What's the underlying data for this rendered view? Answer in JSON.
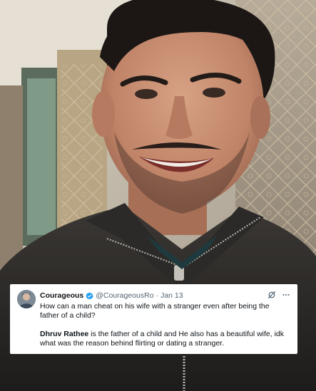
{
  "tweet": {
    "display_name": "Courageous",
    "handle": "@CourageousRo",
    "separator": "·",
    "date": "Jan 13",
    "paragraph1": "How can a man cheat on his wife with a stranger even after being the father of a child?",
    "paragraph2_bold": "Dhruv Rathee",
    "paragraph2_rest": " is the father of a child and He also has a beautiful wife, idk what was the reason behind flirting or dating a stranger.",
    "icons": {
      "verified": "verified-badge-icon",
      "grok": "grok-icon",
      "more": "more-icon"
    }
  },
  "colors": {
    "verified_blue": "#1d9bf0",
    "text_primary": "#0f1419",
    "text_secondary": "#536471",
    "card_bg": "#ffffff"
  }
}
